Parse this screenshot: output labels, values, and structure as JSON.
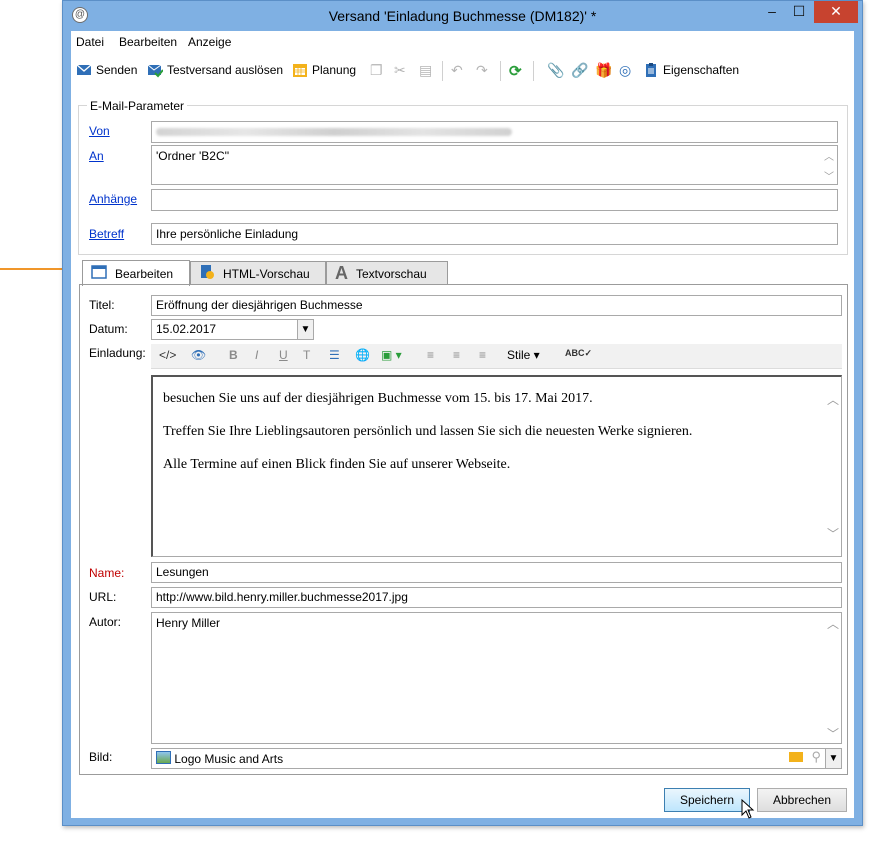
{
  "window": {
    "title": "Versand 'Einladung Buchmesse  (DM182)' *",
    "minimize": "–",
    "maximize": "☐",
    "close": "✕"
  },
  "menu": [
    "Datei",
    "Bearbeiten",
    "Anzeige"
  ],
  "toolbar": {
    "send": "Senden",
    "test_send": "Testversand auslösen",
    "planning": "Planung",
    "properties": "Eigenschaften"
  },
  "email_params": {
    "legend": "E-Mail-Parameter",
    "from_label": "Von",
    "to_label": "An",
    "to_value": "'Ordner 'B2C''",
    "attachments_label": "Anhänge",
    "subject_label": "Betreff",
    "subject_value": "Ihre persönliche Einladung"
  },
  "tabs": [
    {
      "label": "Bearbeiten",
      "icon": "edit-window-icon",
      "active": true
    },
    {
      "label": "HTML-Vorschau",
      "icon": "html-preview-icon",
      "active": false
    },
    {
      "label": "Textvorschau",
      "icon": "text-preview-icon",
      "active": false
    }
  ],
  "form": {
    "title_label": "Titel:",
    "title_value": "Eröffnung der diesjährigen Buchmesse",
    "date_label": "Datum:",
    "date_value": "15.02.2017",
    "invitation_label": "Einladung:",
    "styles_label": "Stile",
    "invitation_text": [
      "besuchen Sie uns auf der diesjährigen Buchmesse vom 15. bis 17. Mai 2017.",
      "Treffen Sie Ihre Lieblingsautoren persönlich und lassen Sie sich die neuesten Werke signieren.",
      "Alle Termine auf einen Blick finden Sie auf unserer Webseite."
    ],
    "name_label": "Name:",
    "name_value": "Lesungen",
    "url_label": "URL:",
    "url_value": "http://www.bild.henry.miller.buchmesse2017.jpg",
    "author_label": "Autor:",
    "author_value": "Henry Miller",
    "image_label": "Bild:",
    "image_value": "Logo Music and Arts"
  },
  "buttons": {
    "save": "Speichern",
    "cancel": "Abbrechen"
  },
  "colors": {
    "window_frame": "#7fb0e3",
    "close_button": "#c7432f",
    "link": "#0033cc",
    "required_label": "#c00000",
    "callout_arrow": "#f0962a"
  }
}
